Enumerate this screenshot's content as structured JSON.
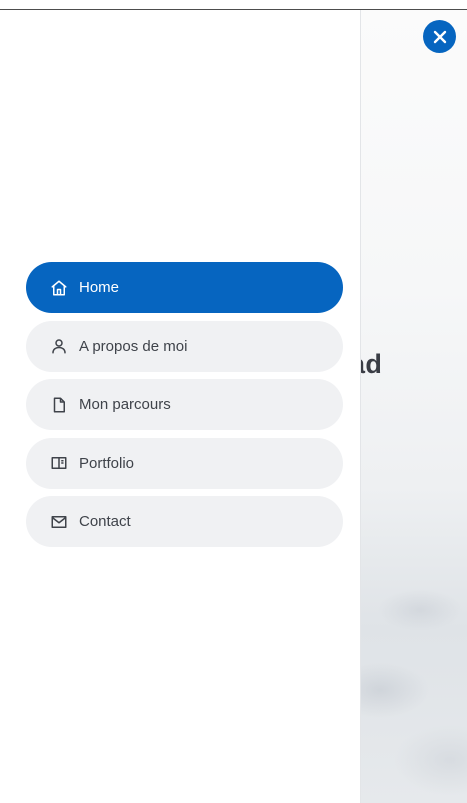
{
  "menu": {
    "items": [
      {
        "label": "Home",
        "icon": "home-icon",
        "active": true
      },
      {
        "label": "A propos de moi",
        "icon": "user-icon",
        "active": false
      },
      {
        "label": "Mon parcours",
        "icon": "document-icon",
        "active": false
      },
      {
        "label": "Portfolio",
        "icon": "book-icon",
        "active": false
      },
      {
        "label": "Contact",
        "icon": "envelope-icon",
        "active": false
      }
    ]
  },
  "background_page": {
    "heading_fragment": "ad"
  },
  "close_button": {
    "icon": "close-icon"
  },
  "colors": {
    "accent": "#0665c0",
    "item_background": "#f0f1f3",
    "item_text": "#3f434a",
    "heading_text": "#3a3d45"
  }
}
